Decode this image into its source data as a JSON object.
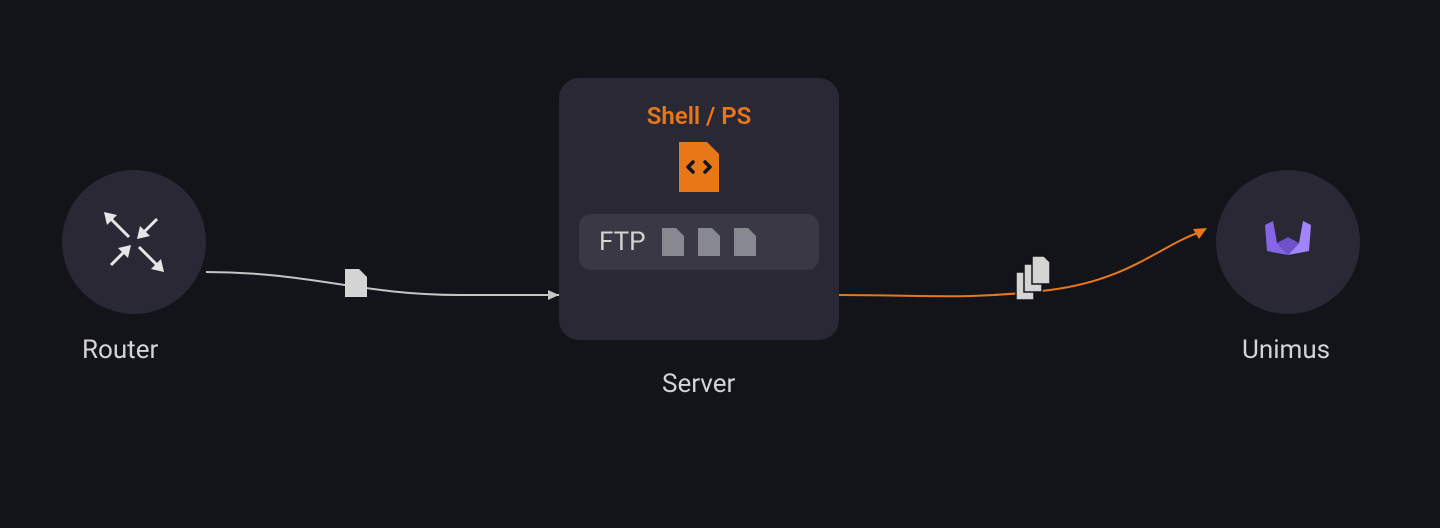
{
  "diagram": {
    "router": {
      "label": "Router"
    },
    "server": {
      "label": "Server",
      "shell_title": "Shell / PS",
      "ftp_label": "FTP"
    },
    "unimus": {
      "label": "Unimus"
    },
    "colors": {
      "bg": "#13131a",
      "node_bg": "#2a2835",
      "inner_bg": "#3a3845",
      "text": "#d4d4d4",
      "accent_orange": "#e87817",
      "line_light": "#c5c5c5",
      "line_orange": "#e87817",
      "file_grey": "#888890",
      "unimus_purple": "#a085ff"
    }
  }
}
